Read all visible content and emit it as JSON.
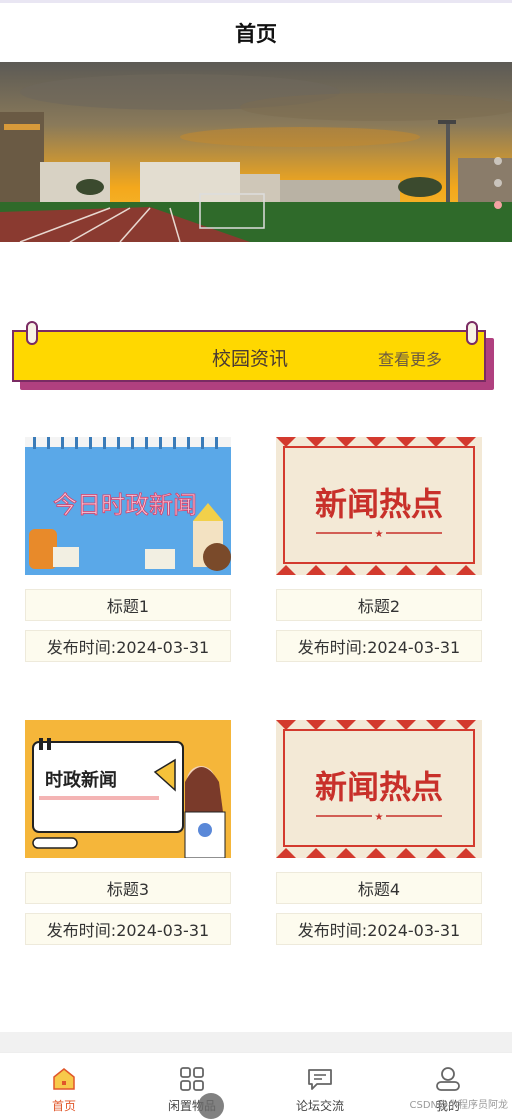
{
  "header": {
    "title": "首页"
  },
  "banner": {
    "slides": 3,
    "active": 2
  },
  "section": {
    "title": "校园资讯",
    "more": "查看更多"
  },
  "thumbs": {
    "t1": "今日时政新闻",
    "t2": "新闻热点",
    "t3": "时政新闻",
    "t4": "新闻热点"
  },
  "cards": [
    {
      "title": "标题1",
      "date": "发布时间:2024-03-31"
    },
    {
      "title": "标题2",
      "date": "发布时间:2024-03-31"
    },
    {
      "title": "标题3",
      "date": "发布时间:2024-03-31"
    },
    {
      "title": "标题4",
      "date": "发布时间:2024-03-31"
    }
  ],
  "tabbar": {
    "items": [
      {
        "label": "首页",
        "icon": "home-icon",
        "active": true
      },
      {
        "label": "闲置物品",
        "icon": "grid-icon"
      },
      {
        "label": "论坛交流",
        "icon": "chat-icon"
      },
      {
        "label": "我的",
        "icon": "user-icon"
      }
    ]
  },
  "watermark": "CSDN@小程序员阿龙",
  "colors": {
    "accent": "#e0572a",
    "sectionYellow": "#ffd800",
    "sectionBorder": "#7a2b63"
  }
}
